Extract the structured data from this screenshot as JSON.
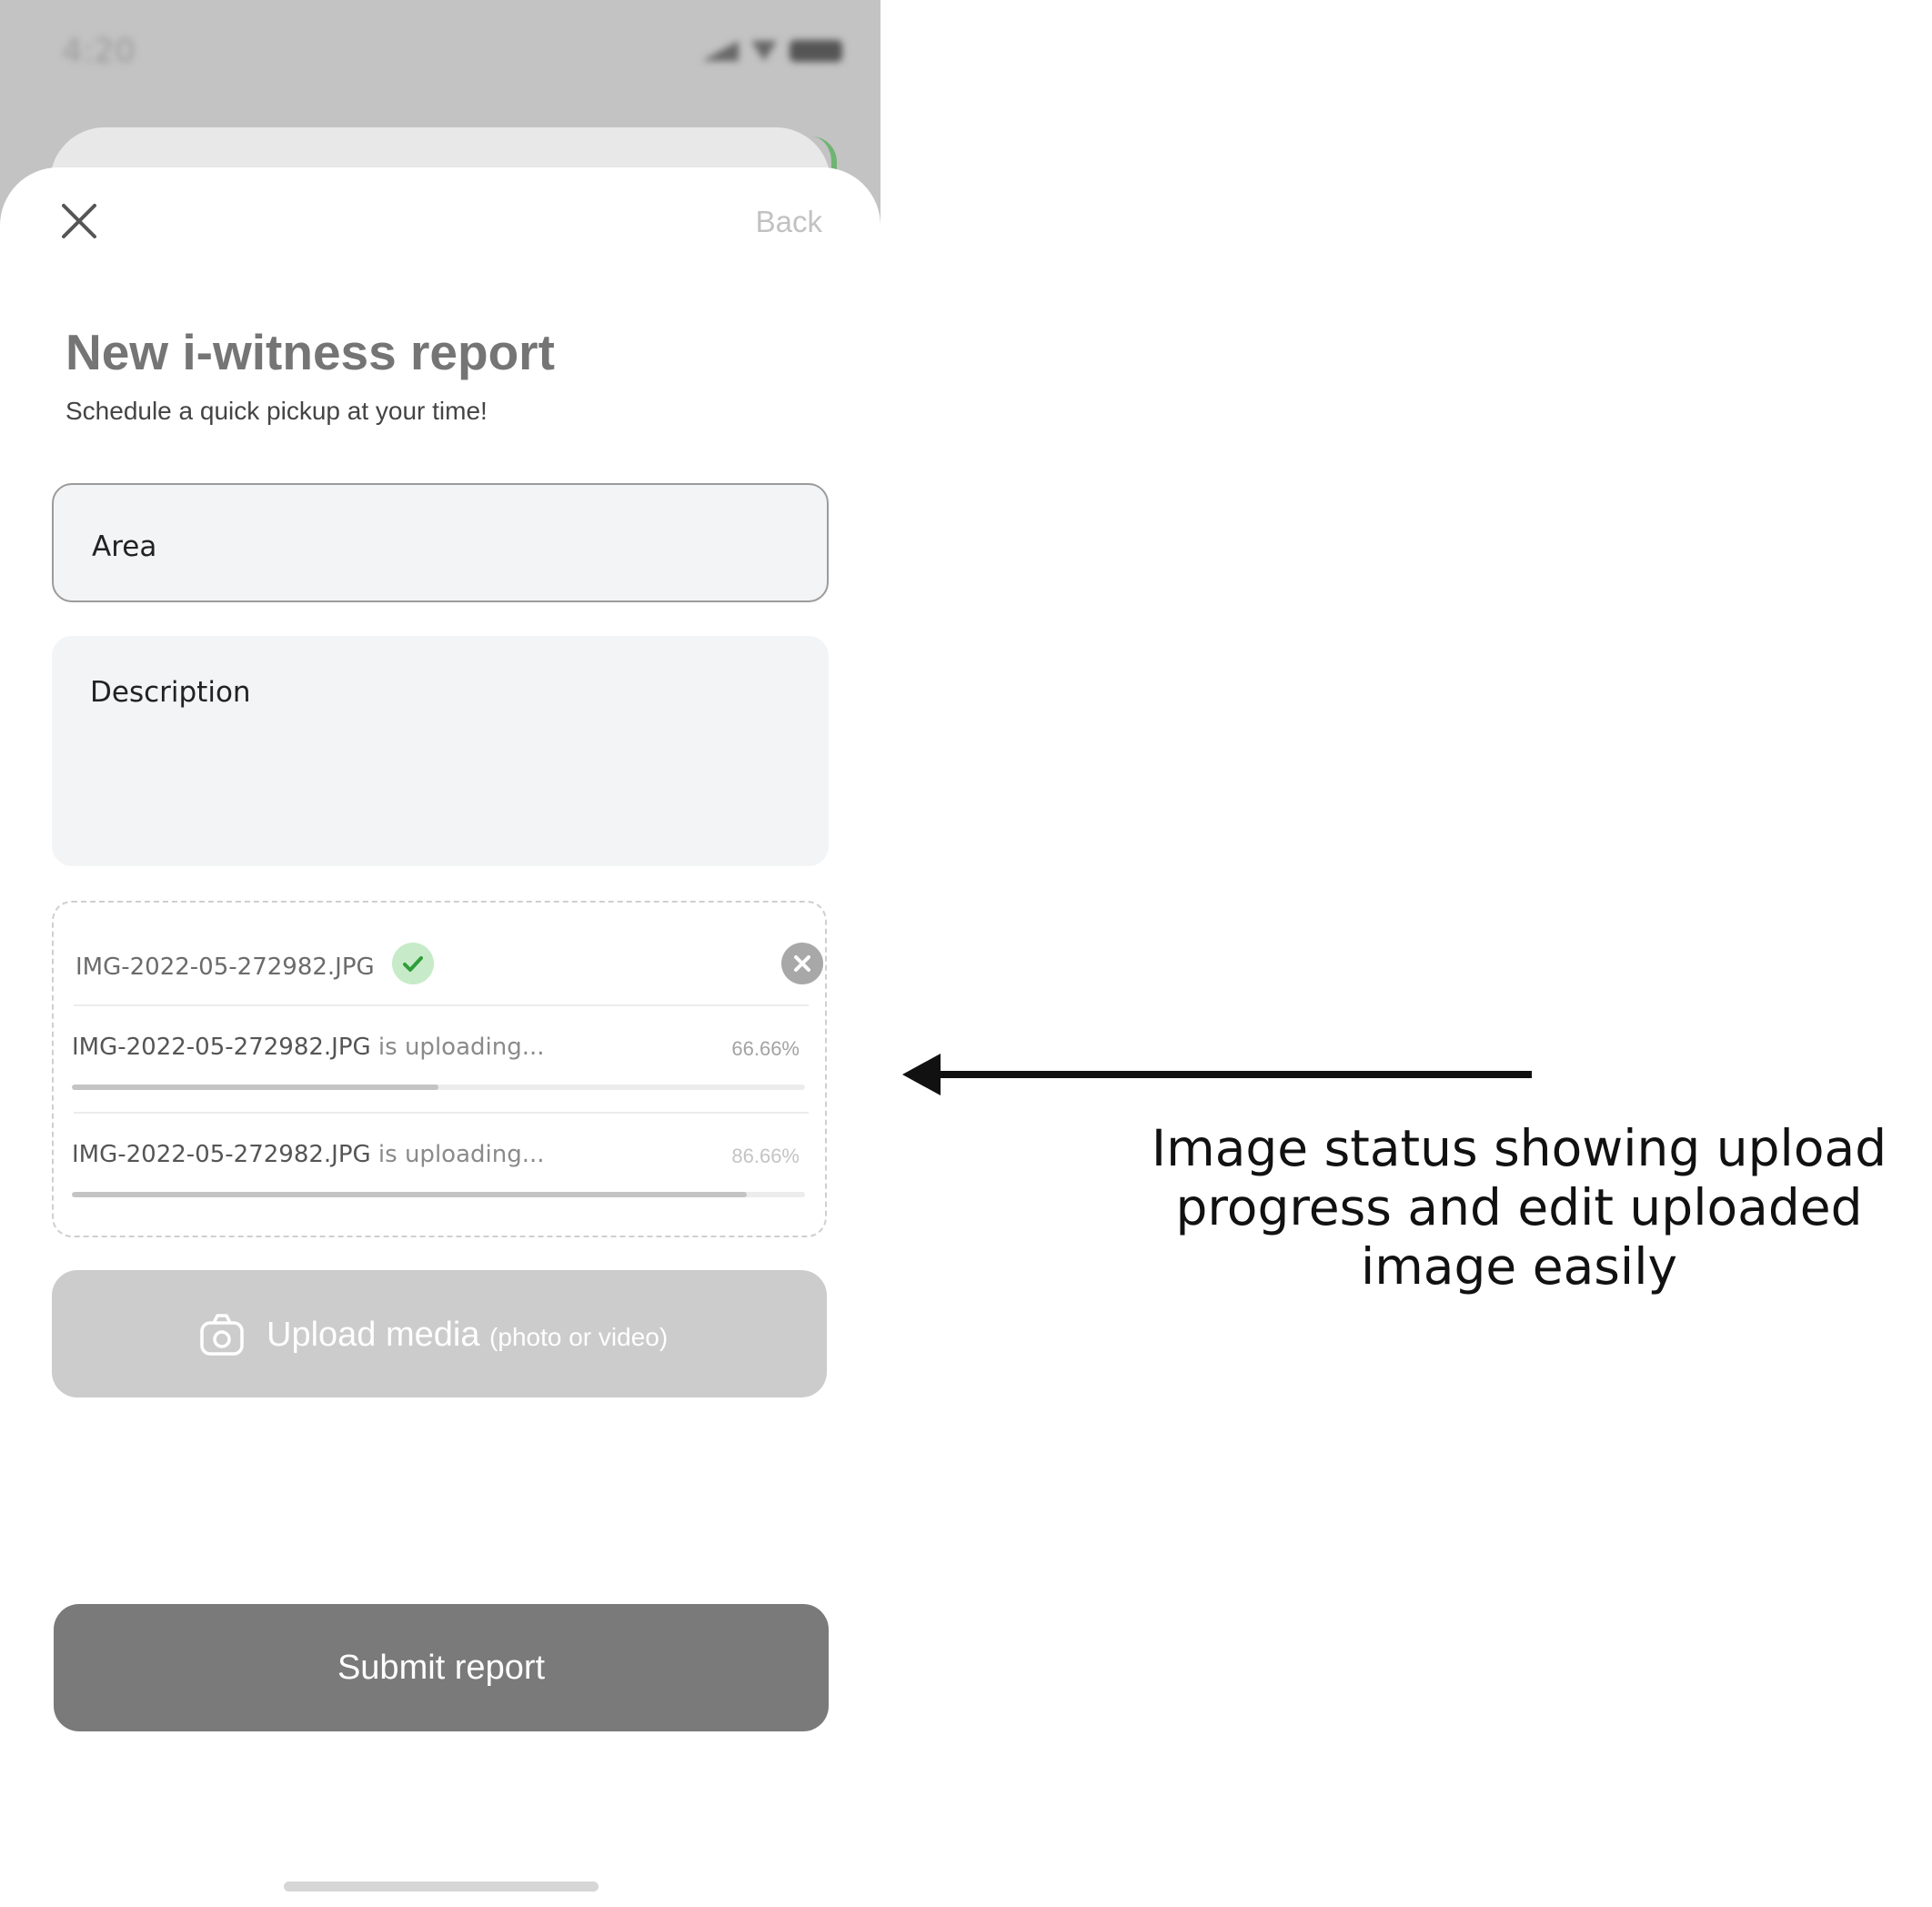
{
  "status_bar": {
    "time": "4:20"
  },
  "header": {
    "close_icon": "close-icon",
    "back_label": "Back"
  },
  "form": {
    "title": "New i-witness report",
    "subtitle": "Schedule a quick pickup at your time!",
    "area_placeholder": "Area",
    "description_placeholder": "Description"
  },
  "uploads": {
    "completed": {
      "filename": "IMG-2022-05-272982.JPG",
      "status_icon": "check-icon",
      "remove_icon": "remove-icon"
    },
    "in_progress": [
      {
        "filename": "IMG-2022-05-272982.JPG",
        "status": "is uploading...",
        "percent_label": "66.66%",
        "progress": 0.5
      },
      {
        "filename": "IMG-2022-05-272982.JPG",
        "status": "is uploading...",
        "percent_label": "86.66%",
        "progress": 0.92
      }
    ]
  },
  "upload_button": {
    "icon": "camera-icon",
    "label": "Upload media",
    "hint": "(photo or video)"
  },
  "submit_button": {
    "label": "Submit report"
  },
  "annotation": {
    "text": "Image status showing upload progress and edit uploaded image easily"
  },
  "colors": {
    "success_bg": "#c7ebc8",
    "success_check": "#2e9e3a",
    "submit_bg": "#7a7a7a",
    "upload_bg": "#cccccc",
    "field_bg": "#f3f4f6"
  }
}
